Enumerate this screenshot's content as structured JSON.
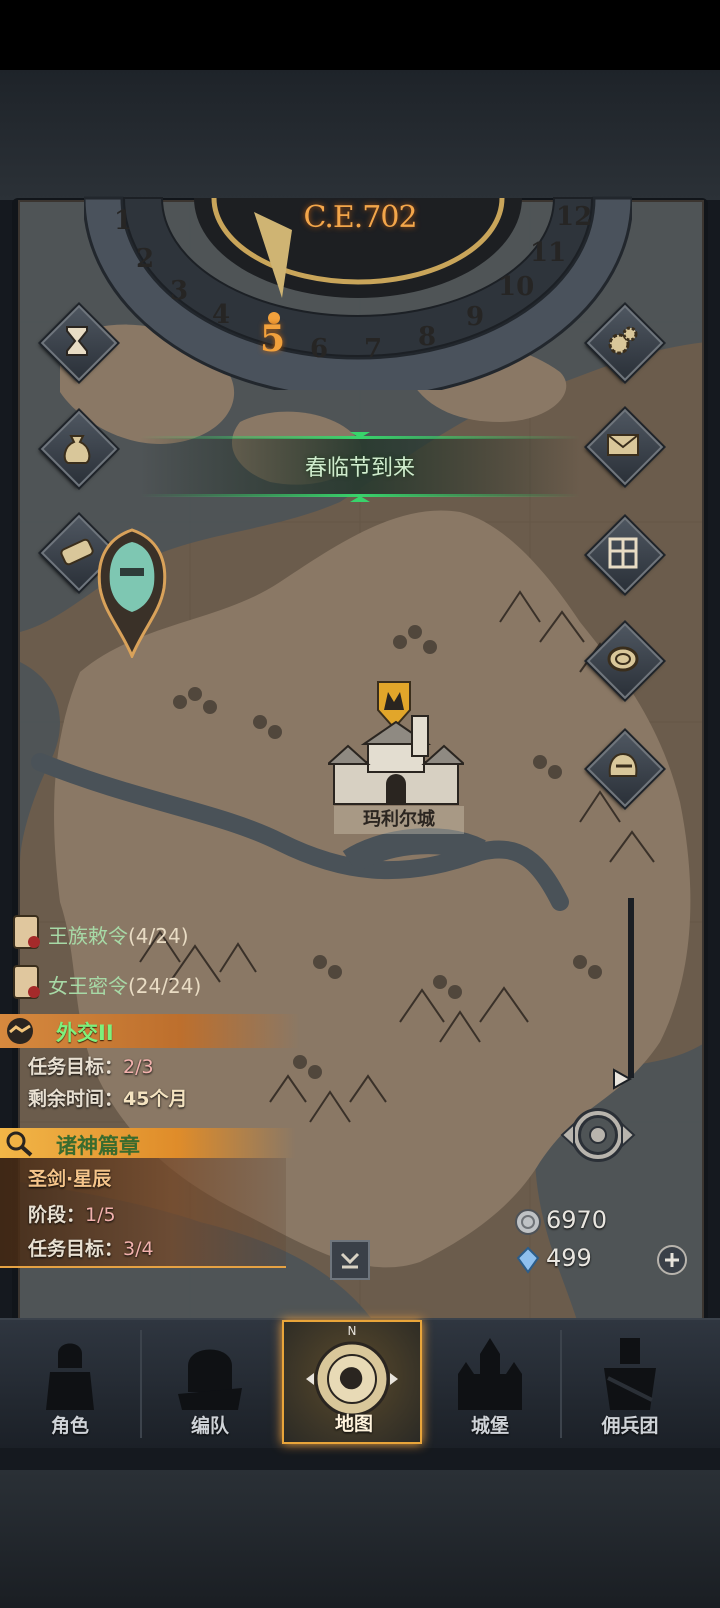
{
  "calendar": {
    "year": "C.E.702",
    "months": [
      "1",
      "2",
      "3",
      "4",
      "5",
      "6",
      "7",
      "8",
      "9",
      "10",
      "11",
      "12"
    ],
    "current_month": "5"
  },
  "event_banner": {
    "text": "春临节到来"
  },
  "city": {
    "name": "玛利尔城"
  },
  "side_buttons_left": [
    "hourglass-icon",
    "money-bag-icon",
    "scroll-icon"
  ],
  "side_buttons_right": [
    "gear-icon",
    "mail-icon",
    "grid-icon",
    "coin-icon",
    "helmet-icon"
  ],
  "quests": [
    {
      "title": "王族敕令",
      "count": "(4/24)"
    },
    {
      "title": "女王密令",
      "count": "(24/24)"
    }
  ],
  "diplomacy": {
    "title": "外交II",
    "target_label": "任务目标：",
    "target_value": "2/3",
    "time_label": "剩余时间：",
    "time_value": "45个月"
  },
  "gods_chapter": {
    "title": "诸神篇章",
    "subtitle": "圣剑·星辰",
    "stage_label": "阶段：",
    "stage_value": "1/5",
    "target_label": "任务目标：",
    "target_value": "3/4"
  },
  "currency": {
    "silver": "6970",
    "crystal": "499"
  },
  "nav": {
    "items": [
      "角色",
      "编队",
      "地图",
      "城堡",
      "佣兵团"
    ],
    "active": "地图",
    "compass_letter": "N"
  },
  "colors": {
    "accent": "#f2a13c",
    "quest_green": "#a7d9a6",
    "banner_green": "#39d36b"
  }
}
